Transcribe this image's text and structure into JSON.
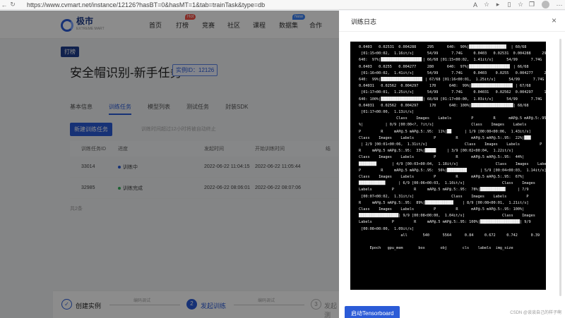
{
  "browser": {
    "url": "https://www.cvmart.net/instance/12126?hasBT=0&hasMT=1&tab=trainTask&type=db"
  },
  "header": {
    "logo_name": "极市",
    "logo_sub": "EXTREME MART",
    "nav": [
      "首页",
      "打榜",
      "竞赛",
      "社区",
      "课程",
      "数据集",
      "合作"
    ],
    "hot_badge": "Hot",
    "new_badge": "New"
  },
  "page": {
    "tag": "打榜",
    "title": "安全帽识别-新手任务",
    "instance_id": "实例ID：12126",
    "tabs": [
      "基本信息",
      "训练任务",
      "模型列表",
      "测试任务",
      "封装SDK"
    ],
    "new_task_button": "新建训练任务",
    "hint": "训练时间超过12小时将被自动终止",
    "table": {
      "headers": [
        "训练任务ID",
        "进度",
        "发起时间",
        "开始训练时间",
        "结"
      ],
      "rows": [
        {
          "id": "33014",
          "status": "训练中",
          "status_color": "#2b5bd7",
          "start": "2022-06-22 11:04:15",
          "train_start": "2022-06-22 11:05:44"
        },
        {
          "id": "32985",
          "status": "训练完成",
          "status_color": "#35b35b",
          "start": "2022-06-22 08:06:01",
          "train_start": "2022-06-22 08:07:06"
        }
      ]
    },
    "total": "共2条"
  },
  "steps": {
    "step1": "创建实例",
    "step1_note": "编码调试",
    "step2_num": "2",
    "step2": "发起训练",
    "step2_note": "编码调试",
    "step3_num": "3",
    "step3": "发起测"
  },
  "drawer": {
    "title": "训练日志",
    "close": "×",
    "tensorboard_button": "启动Tensorboard",
    "log_lines": [
      "0.0403   0.02531  0.004288     295      640:  90%|████████████████▉  | 60/68",
      " [01:15<00:02,  1.16it/s]      54/99      7.74G     0.0403   0.02531  0.004288     295",
      "640:  97%|██████████████████▌| 66/68 [01:15<00:02,  1.41it/s]      54/99      7.74G",
      "0.0403   0.0255   0.004277     280      640:  97%|██████████████████▌ | 66/68",
      " [01:16<00:02,  1.41it/s]      54/99      7.74G     0.0403    0.0255   0.004277     280",
      "640:  99%|██████████████████▊ | 67/68 [01:16<00:01,  1.25it/s]      54/99      7.74G",
      "0.04031   0.02562  0.004297     170      640:  99%|██████████████████▊ | 67/68",
      " [01:17<00:01,  1.25it/s]      54/99      7.74G     0.04031   0.02562  0.004297     170",
      "640: 100%|███████████████████| 68/68 [01:17<00:00,  1.03it/s]      54/99      7.74G",
      "0.04031   0.02562  0.004297     170      640: 100%|███████████████████| 68/68",
      " [01:17<00:00,  1.13it/s]",
      "                 Class    Images    Labels         P         R      mAP@.5 mAP@.5:.95:  0",
      "%|          | 0/9 [00:00<?, ?it/s]                 Class    Images    Labels",
      "P         R     mAP@.5 mAP@.5:.95:  11%|██      | 1/9 [00:00<00:06,  1.43it/s]",
      "Class    Images    Labels         P         R      mAP@.5 mAP@.5:.95:  22%|███",
      " | 2/9 [00:01<00:06,  1.31it/s]                 Class    Images    Labels         P",
      "R     mAP@.5 mAP@.5:.95:  33%|█████     | 3/9 [00:02<00:04,  1.22it/s]",
      "Class    Images    Labels         P         R      mAP@.5 mAP@.5:.95:  44%|",
      "████████       | 4/9 [00:03<00:04,  1.18it/s]                 Class    Images    Labels",
      "P         R     mAP@.5 mAP@.5:.95:  56%|█████████      | 5/9 [00:04<00:03,  1.14it/s]",
      "Class    Images    Labels         P         R      mAP@.5 mAP@.5:.95:  67%|",
      "████████████      | 6/9 [00:06<00:03,  1.10it/s]                 Class    Images",
      "Labels         P         R     mAP@.5 mAP@.5:.95:  78%|███████████▌     | 7/9",
      " [00:07<00:02,  1.31it/s]                 Class    Images    Labels         P",
      "R     mAP@.5 mAP@.5:.95:  89%|████████████▉    | 8/9 [00:08<00:01,  1.21it/s]",
      "Class    Images    Labels         P         R      mAP@.5 mAP@.5:.95: 100%|",
      "██████████████████| 9/9 [00:08<00:00,  1.04it/s]                 Class    Images",
      "Labels         P         R     mAP@.5 mAP@.5:.95: 100%|██████████████████| 9/9",
      " [00:08<00:00,  1.09it/s]",
      "                   all       540      5564      0.84     0.672     0.742      0.39",
      "",
      "     Epoch   gpu_mem       box       obj       cls    labels  img_size"
    ]
  },
  "watermark": "CSDN @谈谈自己的样子啊"
}
